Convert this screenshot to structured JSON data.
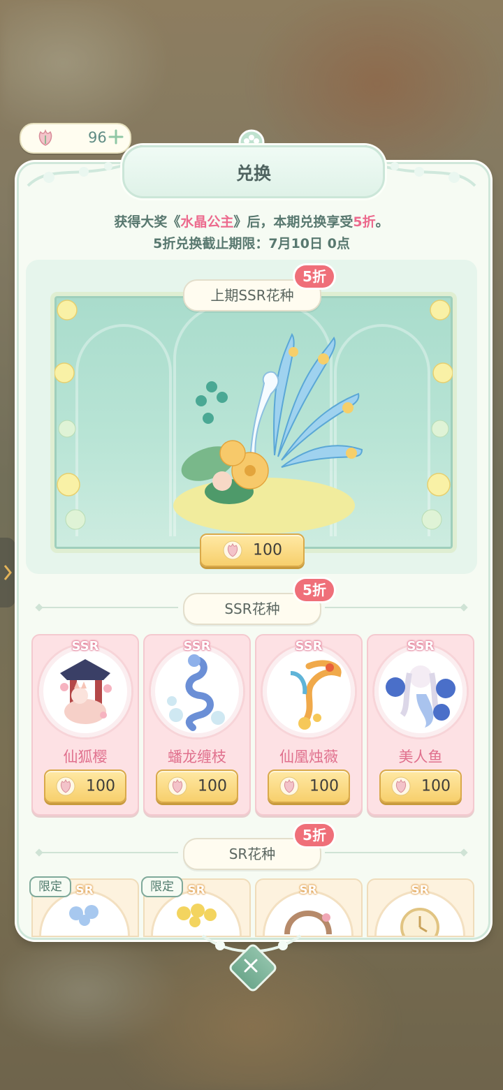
{
  "currency": {
    "amount": "96"
  },
  "dialog": {
    "title": "兑换",
    "notice_line1_prefix": "获得大奖《",
    "notice_line1_highlight": "水晶公主",
    "notice_line1_mid": "》后，本期兑换享受",
    "notice_line1_discount": "5折",
    "notice_line1_suffix": "。",
    "notice_line2": "5折兑换截止期限：7月10日 0点"
  },
  "featured": {
    "label": "上期SSR花种",
    "badge": "5折",
    "price": "100"
  },
  "ssr_section": {
    "label": "SSR花种",
    "badge": "5折",
    "items": [
      {
        "rarity": "SSR",
        "name": "仙狐樱",
        "price": "100"
      },
      {
        "rarity": "SSR",
        "name": "蟠龙缠枝",
        "price": "100"
      },
      {
        "rarity": "SSR",
        "name": "仙凰烛薇",
        "price": "100"
      },
      {
        "rarity": "SSR",
        "name": "美人鱼",
        "price": "100"
      }
    ]
  },
  "sr_section": {
    "label": "SR花种",
    "badge": "5折",
    "items": [
      {
        "rarity": "SR",
        "tag": "限定"
      },
      {
        "rarity": "SR",
        "tag": "限定"
      },
      {
        "rarity": "SR",
        "tag": ""
      },
      {
        "rarity": "SR",
        "tag": ""
      }
    ]
  },
  "colors": {
    "accent_pink": "#ec6a8d",
    "badge_red": "#ef6f79",
    "teal": "#58786f",
    "gold": "#f7cf6c"
  },
  "icons": {
    "currency": "flower-seed-icon",
    "add": "plus-icon",
    "close": "close-icon"
  }
}
